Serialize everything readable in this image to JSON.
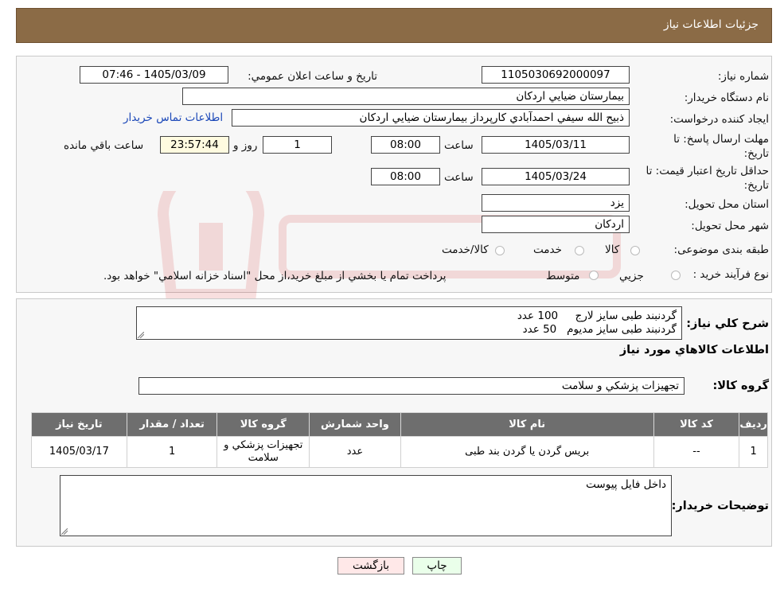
{
  "header": {
    "title": "جزئیات اطلاعات نیاز"
  },
  "form": {
    "need_number_label": "شماره نیاز:",
    "need_number": "1105030692000097",
    "announce_label": "تاریخ و ساعت اعلان عمومي:",
    "announce_value": "1405/03/09 - 07:46",
    "buyer_org_label": "نام دستگاه خريدار:",
    "buyer_org": "بيمارستان ضيايي اردكان",
    "requester_label": "ايجاد کننده درخواست:",
    "requester": "ذبيح الله سيفي احمدآبادي كارپرداز بيمارستان ضيايي اردكان",
    "contact_link": "اطلاعات تماس خريدار",
    "deadline_label": "مهلت ارسال پاسخ: تا تاريخ:",
    "deadline_date": "1405/03/11",
    "time_label": "ساعت",
    "deadline_time": "08:00",
    "days_value": "1",
    "days_label": "روز و",
    "remaining_time": "23:57:44",
    "remaining_label": "ساعت باقي مانده",
    "validity_label": "حداقل تاريخ اعتبار قيمت: تا تاريخ:",
    "validity_date": "1405/03/24",
    "validity_time": "08:00",
    "province_label": "استان محل تحويل:",
    "province": "يزد",
    "city_label": "شهر محل تحويل:",
    "city": "اردكان",
    "category_label": "طبقه بندی موضوعی:",
    "category_options": [
      "كالا",
      "خدمت",
      "كالا/خدمت"
    ],
    "process_label": "نوع فرآيند خريد :",
    "process_options": [
      "جزيي",
      "متوسط"
    ],
    "process_note": "پرداخت تمام يا بخشي از مبلغ خريد،از محل \"اسناد خزانه اسلامي\" خواهد بود."
  },
  "summary": {
    "label": "شرح كلي نياز:",
    "line1": "گردنبند طبی سایز لارج     100 عدد",
    "line2": "گردنبند طبی سایز مدیوم   50 عدد",
    "goods_info_title": "اطلاعات كالاهاي مورد نياز",
    "goods_group_label": "گروه كالا:",
    "goods_group": "تجهيزات پزشكي و سلامت"
  },
  "table": {
    "headers": [
      "رديف",
      "كد كالا",
      "نام كالا",
      "واحد شمارش",
      "گروه كالا",
      "تعداد / مقدار",
      "تاريخ نياز"
    ],
    "rows": [
      [
        "1",
        "--",
        "بريس گردن يا گردن بند طبی",
        "عدد",
        "تجهيزات پزشكي و سلامت",
        "1",
        "1405/03/17"
      ]
    ]
  },
  "buyer_notes": {
    "label": "توضيحات خريدار:",
    "text": "داخل فایل پیوست"
  },
  "buttons": {
    "print": "چاپ",
    "back": "بازگشت"
  },
  "colors": {
    "header_bg": "#8b6b46",
    "table_header_bg": "#6e6e6e",
    "link": "#1a47b8",
    "print_btn": "#eaffea",
    "back_btn": "#ffe8e8"
  }
}
